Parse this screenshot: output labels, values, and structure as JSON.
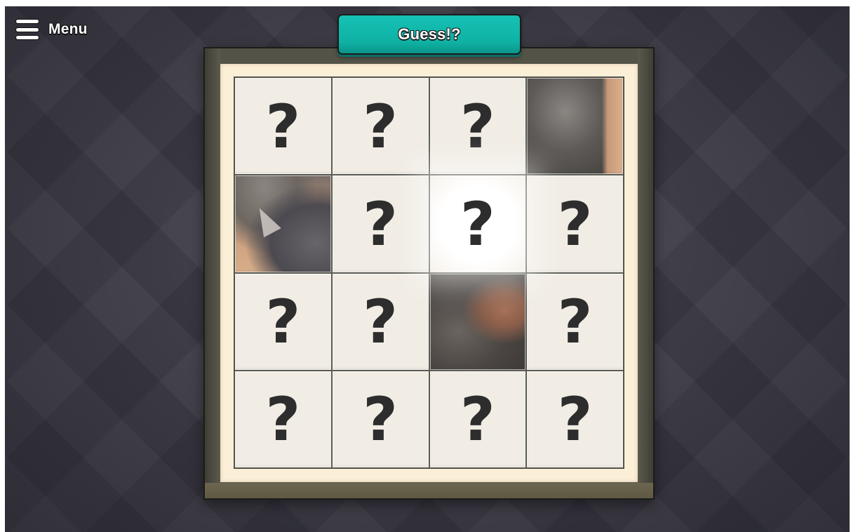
{
  "menu": {
    "label": "Menu",
    "icon": "hamburger-icon"
  },
  "guess_button": {
    "label": "Guess!?"
  },
  "board": {
    "rows": 4,
    "cols": 4,
    "hidden_symbol": "?",
    "tiles": [
      {
        "state": "hidden"
      },
      {
        "state": "hidden"
      },
      {
        "state": "hidden"
      },
      {
        "state": "revealed",
        "image": "animal-fur-piece"
      },
      {
        "state": "revealed",
        "image": "animal-ear-piece"
      },
      {
        "state": "hidden"
      },
      {
        "state": "hidden",
        "highlighted": true
      },
      {
        "state": "hidden"
      },
      {
        "state": "hidden"
      },
      {
        "state": "hidden"
      },
      {
        "state": "revealed",
        "image": "animal-fur-piece"
      },
      {
        "state": "hidden"
      },
      {
        "state": "hidden"
      },
      {
        "state": "hidden"
      },
      {
        "state": "hidden"
      },
      {
        "state": "hidden"
      }
    ]
  },
  "colors": {
    "accent": "#11b8ab",
    "frame": "#545348",
    "mat": "#fcefd8",
    "tile": "#f1ede5",
    "symbol": "#2d2d2d",
    "background": "#3b3a44"
  }
}
